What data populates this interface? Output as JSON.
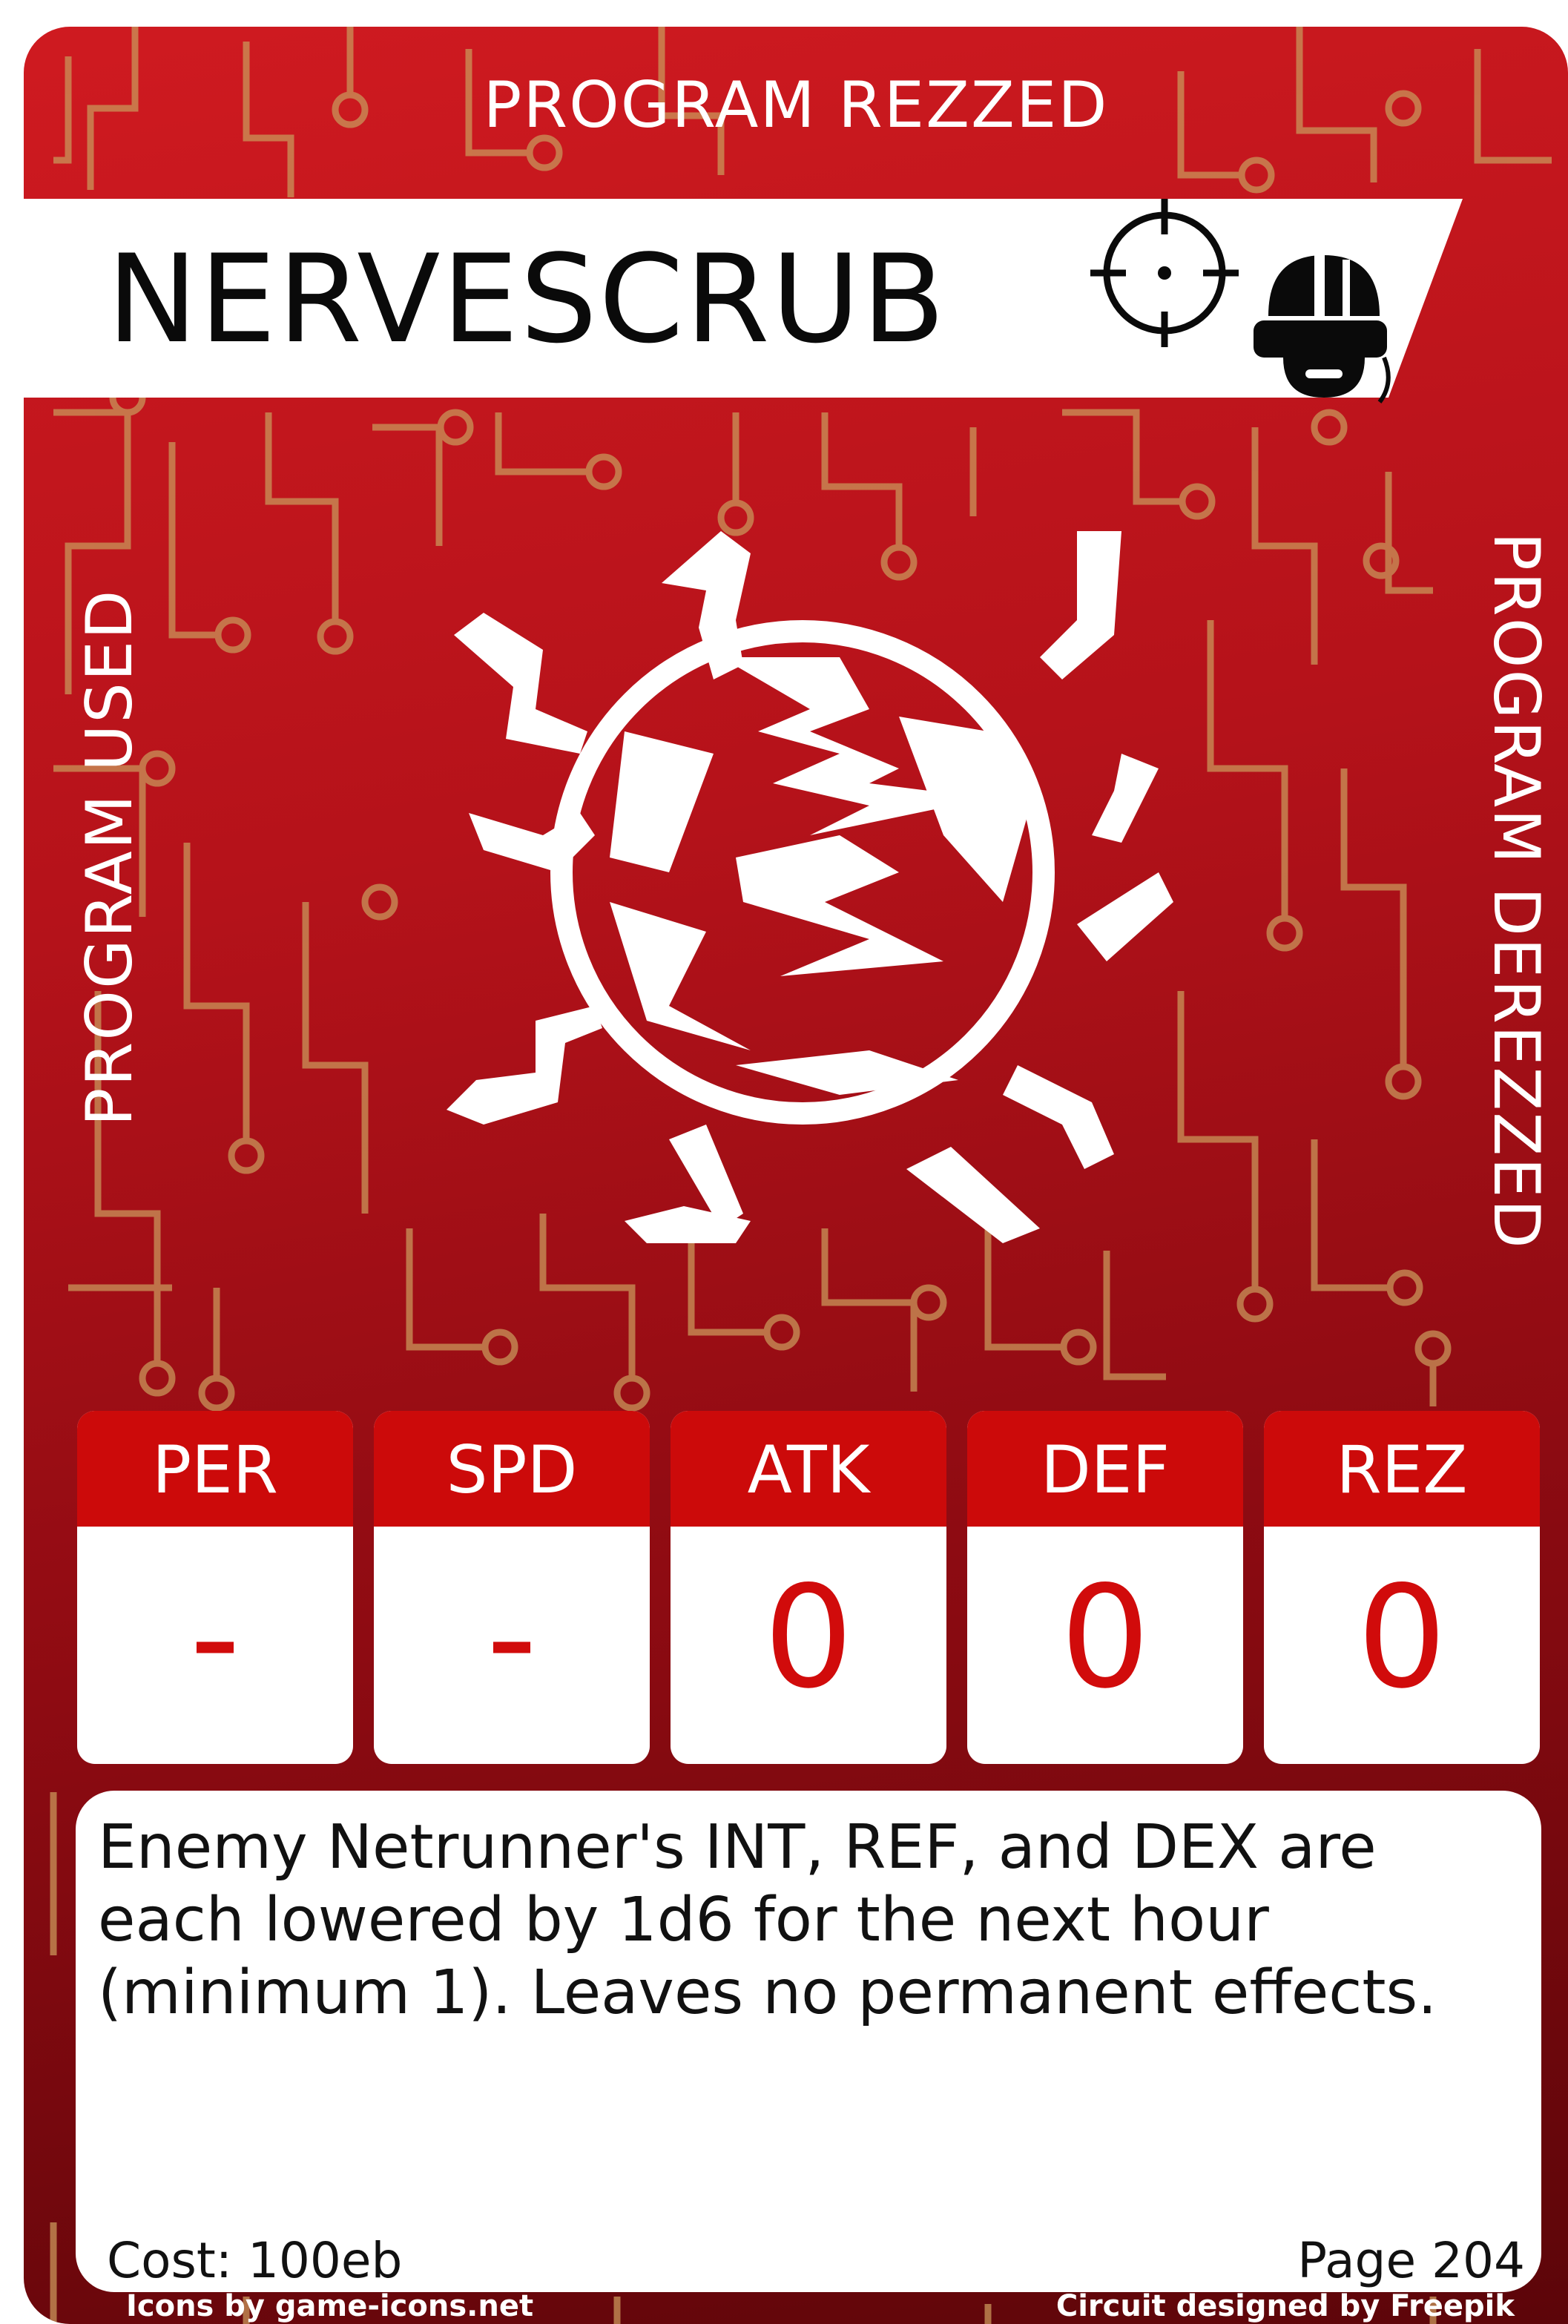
{
  "card": {
    "title": "NERVESCRUB",
    "edge_labels": {
      "top": "PROGRAM REZZED",
      "left": "PROGRAM USED",
      "right": "PROGRAM DEREZZED"
    },
    "type_icons": [
      "crosshair-icon",
      "netrunner-helmet-icon"
    ],
    "emblem_icon": "bug-lightning-icon"
  },
  "stats": [
    {
      "label": "PER",
      "value": "-"
    },
    {
      "label": "SPD",
      "value": "-"
    },
    {
      "label": "ATK",
      "value": "0"
    },
    {
      "label": "DEF",
      "value": "0"
    },
    {
      "label": "REZ",
      "value": "0"
    }
  ],
  "description": {
    "effect": "Enemy Netrunner's INT, REF, and DEX are each lowered by 1d6 for the next hour (minimum 1). Leaves no permanent effects.",
    "cost": "Cost: 100eb",
    "page": "Page 204"
  },
  "credits": {
    "icons": "Icons by game-icons.net",
    "circuit": "Circuit designed by Freepik"
  },
  "colors": {
    "card_red": "#cf1a20",
    "card_dark_red": "#5c0509",
    "stat_header": "#cc0a0a",
    "stat_value": "#d10b0b",
    "circuit_trace": "#c9955a"
  }
}
